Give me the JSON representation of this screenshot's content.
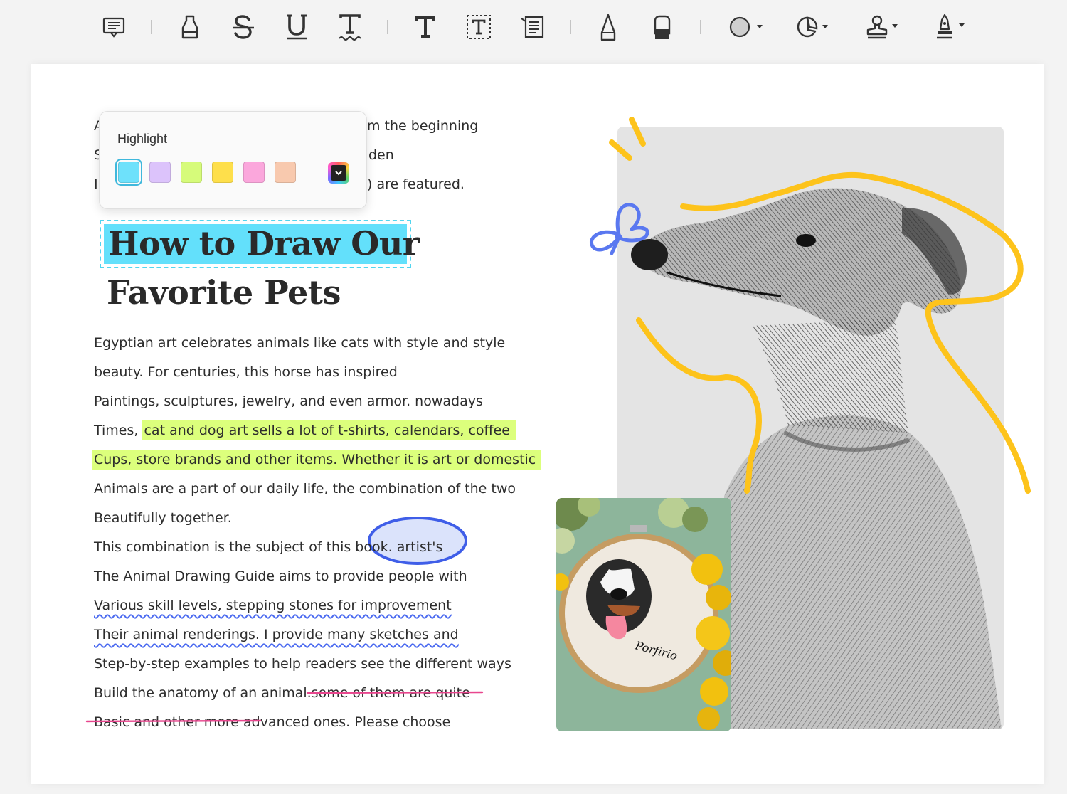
{
  "toolbar": {
    "tools": [
      {
        "name": "comment-icon"
      },
      {
        "name": "highlighter-icon"
      },
      {
        "name": "strikethrough-icon"
      },
      {
        "name": "underline-icon"
      },
      {
        "name": "squiggly-icon"
      },
      {
        "name": "text-icon"
      },
      {
        "name": "textbox-icon"
      },
      {
        "name": "callout-icon"
      },
      {
        "name": "pencil-icon"
      },
      {
        "name": "eraser-icon"
      },
      {
        "name": "shape-icon"
      },
      {
        "name": "area-highlight-icon"
      },
      {
        "name": "stamp-icon"
      },
      {
        "name": "signature-icon"
      }
    ]
  },
  "popup": {
    "title": "Highlight",
    "swatches": [
      "#6ee1fb",
      "#dcc3fb",
      "#d6fb7a",
      "#fedf4b",
      "#fba7dc",
      "#f8c9ae"
    ],
    "selected": "#6ee1fb"
  },
  "document": {
    "hidden_lines": [
      {
        "left": "A",
        "right": "m the beginning"
      },
      {
        "left": "S",
        "right": "den"
      },
      {
        "left": "I",
        "right": ") are featured."
      }
    ],
    "title_line1": "How to Draw Our",
    "title_line2": "Favorite Pets",
    "body": {
      "l1": "Egyptian art celebrates animals like cats with style and style",
      "l2": "beauty. For centuries, this horse has inspired",
      "l3": "Paintings, sculptures, jewelry, and even armor. nowadays",
      "l4a": "Times, ",
      "l4b": "cat and dog art sells a lot of t-shirts, calendars, coffee",
      "l5": "Cups, store brands and other items. Whether it is art or domestic",
      "l6": "Animals are a part of our daily life, the combination of the two",
      "l7": "Beautifully together.",
      "l8": "This combination is the subject of this book. artist's",
      "l9": "The Animal Drawing Guide aims to provide people with",
      "l10": "Various skill levels, stepping stones for improvement",
      "l11": "Their animal renderings. I provide many sketches and",
      "l12": "Step-by-step examples to help readers see the different ways",
      "l13a": "Build the anatomy of an animal.",
      "l13b": "some of them are quite",
      "l14a": "Basic and other more ad",
      "l14b": "vanced ones. Please choose"
    },
    "embroidery_text": "Porfirio"
  },
  "colors": {
    "cyan_highlight": "#63e0fb",
    "green_highlight": "#dcff7c",
    "ellipse_fill": "#dbe3fb",
    "ellipse_stroke": "#3f5ee8",
    "strike": "#e8468e",
    "squiggle": "#4d6cf0",
    "doodle_yellow": "#fdc31b",
    "butterfly_blue": "#5a78f0"
  }
}
